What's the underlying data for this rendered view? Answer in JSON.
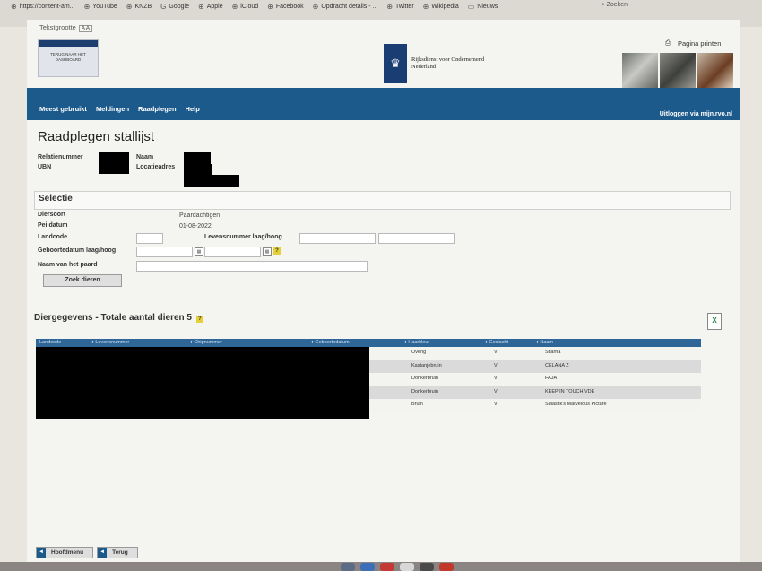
{
  "browser": {
    "bookmarks": [
      {
        "icon": "globe-icon",
        "label": "https://content-am..."
      },
      {
        "icon": "globe-icon",
        "label": "YouTube"
      },
      {
        "icon": "globe-icon",
        "label": "KNZB"
      },
      {
        "icon": "google-icon",
        "label": "Google"
      },
      {
        "icon": "globe-icon",
        "label": "Apple"
      },
      {
        "icon": "globe-icon",
        "label": "iCloud"
      },
      {
        "icon": "globe-icon",
        "label": "Facebook"
      },
      {
        "icon": "globe-icon",
        "label": "Opdracht details - ..."
      },
      {
        "icon": "globe-icon",
        "label": "Twitter"
      },
      {
        "icon": "globe-icon",
        "label": "Wikipedia"
      },
      {
        "icon": "folder-icon",
        "label": "Nieuws"
      }
    ],
    "search_placeholder": "Zoeken"
  },
  "header": {
    "text_size_label": "Tekstgrootte",
    "back_to_dashboard": "TERUG NAAR HET DASHBOARD",
    "logo_line1": "Rijksdienst voor Ondernemend",
    "logo_line2": "Nederland",
    "print_label": "Pagina printen"
  },
  "nav": {
    "items": [
      "Meest gebruikt",
      "Meldingen",
      "Raadplegen",
      "Help"
    ],
    "logout": "Uitloggen via mijn.rvo.nl"
  },
  "page": {
    "title": "Raadplegen stallijst",
    "relatie_label": "Relatienummer",
    "ubn_label": "UBN",
    "naam_label": "Naam",
    "locatie_label": "Locatieadres"
  },
  "selectie": {
    "title": "Selectie",
    "diersoort_label": "Diersoort",
    "diersoort_value": "Paardachtigen",
    "peildatum_label": "Peildatum",
    "peildatum_value": "01-08-2022",
    "landcode_label": "Landcode",
    "levensnummer_label": "Levensnummer laag/hoog",
    "geboortedatum_label": "Geboortedatum laag/hoog",
    "naam_paard_label": "Naam van het paard",
    "search_button": "Zoek dieren"
  },
  "diergegevens": {
    "title": "Diergegevens - Totale aantal dieren 5",
    "columns": [
      "Landcode",
      "Levensnummer",
      "Chipnummer",
      "Geboortedatum",
      "Haarkleur",
      "Geslacht",
      "Naam"
    ],
    "rows": [
      {
        "haarkleur": "Overig",
        "geslacht": "V",
        "naam": "Stjarna"
      },
      {
        "haarkleur": "Kastanjebruin",
        "geslacht": "V",
        "naam": "CELANA Z"
      },
      {
        "haarkleur": "Donkerbruin",
        "geslacht": "V",
        "naam": "FAJA"
      },
      {
        "haarkleur": "Donkerbruin",
        "geslacht": "V",
        "naam": "KEEP IN TOUCH VDE"
      },
      {
        "haarkleur": "Bruin",
        "geslacht": "V",
        "naam": "Sulastik's Marvelous Picture"
      }
    ]
  },
  "footer": {
    "main_menu": "Hoofdmenu",
    "back": "Terug"
  },
  "colors": {
    "brand_blue": "#1c5a8c",
    "table_header": "#2f6698",
    "logo_blue": "#1a3d73"
  }
}
